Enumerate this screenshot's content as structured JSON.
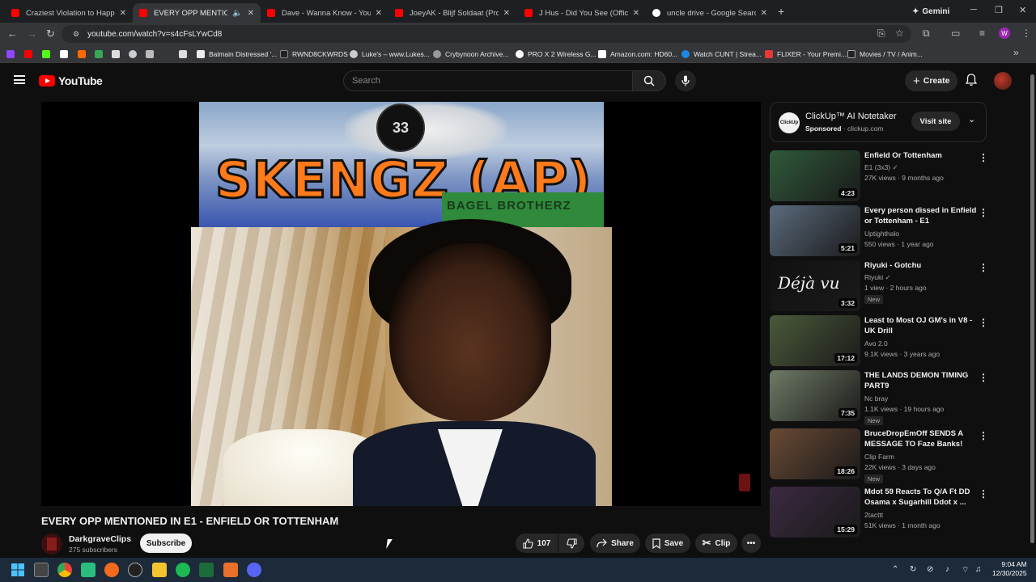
{
  "browser": {
    "tabs": [
      {
        "title": "Craziest Violation to Happen in",
        "color": "#ff0000"
      },
      {
        "title": "EVERY OPP MENTIONED IN",
        "color": "#ff0000"
      },
      {
        "title": "Dave - Wanna Know - YouTube",
        "color": "#ff0000"
      },
      {
        "title": "JoeyAK - Blijf Soldaat (Prod. Gu",
        "color": "#ff0000"
      },
      {
        "title": "J Hus - Did You See (Official Vi",
        "color": "#ff0000"
      },
      {
        "title": "uncle drive - Google Search",
        "color": "#4285f4"
      }
    ],
    "gemini_label": "Gemini",
    "url": "youtube.com/watch?v=s4cFsLYwCd8",
    "profile_letter": "W",
    "bookmarks": [
      "Balmain Distressed '...",
      "RWND8CKWRDS",
      "Luke's – www.Lukes...",
      "Crybynoon Archive...",
      "PRO X 2 Wireless G...",
      "Amazon.com: HD60...",
      "Watch CUNT | Strea...",
      "FLIXER - Your Premi...",
      "Movies / TV / Anim..."
    ]
  },
  "youtube": {
    "logo_text": "YouTube",
    "search_placeholder": "Search",
    "create_label": "Create",
    "thumbnail": {
      "badge": "33",
      "headline": "SKENGZ (AP)",
      "banner": "BAGEL BROTHERZ"
    },
    "video": {
      "title": "EVERY OPP MENTIONED IN E1 - ENFIELD OR TOTTENHAM",
      "channel": "DarkgraveClips",
      "subscribers": "275 subscribers",
      "subscribe_label": "Subscribe",
      "likes": "107",
      "share_label": "Share",
      "save_label": "Save",
      "clip_label": "Clip"
    },
    "ad": {
      "logo": "ClickUp",
      "title": "ClickUp™ AI Notetaker",
      "sponsored": "Sponsored",
      "domain": "· clickup.com",
      "visit_label": "Visit site"
    },
    "recommendations": [
      {
        "title": "Enfield Or Tottenham",
        "channel": "E1 (3x3)",
        "verified": true,
        "meta": "27K views · 9 months ago",
        "duration": "4:23",
        "new": false,
        "thumb": "#2f5a3a"
      },
      {
        "title": "Every person dissed in Enfield or Tottenham - E1",
        "channel": "Uptighthalo",
        "verified": false,
        "meta": "550 views · 1 year ago",
        "duration": "5:21",
        "new": false,
        "thumb": "#5b6b7d"
      },
      {
        "title": "Riyuki - Gotchu",
        "channel": "Riyuki",
        "verified": true,
        "meta": "1 view · 2 hours ago",
        "duration": "3:32",
        "new": true,
        "thumb": "#111111",
        "overlay": "Déjà vu"
      },
      {
        "title": "Least to Most OJ GM's in V8 - UK Drill",
        "channel": "Avo 2.0",
        "verified": false,
        "meta": "9.1K views · 3 years ago",
        "duration": "17:12",
        "new": false,
        "thumb": "#4b5a3a"
      },
      {
        "title": "THE LANDS DEMON TIMING PART9",
        "channel": "Nc bray",
        "verified": false,
        "meta": "1.1K views · 19 hours ago",
        "duration": "7:35",
        "new": true,
        "thumb": "#6f7a66"
      },
      {
        "title": "BruceDropEmOff SENDS A MESSAGE TO Faze Banks!",
        "channel": "Clip Farm",
        "verified": false,
        "meta": "22K views · 3 days ago",
        "duration": "18:26",
        "new": true,
        "thumb": "#6a4a34"
      },
      {
        "title": "Mdot 59 Reacts To Q/A Ft DD Osama x Sugarhill Ddot x ...",
        "channel": "2tacttt",
        "verified": false,
        "meta": "51K views · 1 month ago",
        "duration": "15:29",
        "new": false,
        "thumb": "#3a2a40"
      }
    ],
    "new_label": "New"
  },
  "taskbar": {
    "time": "9:04 AM",
    "date": "12/30/2025"
  }
}
